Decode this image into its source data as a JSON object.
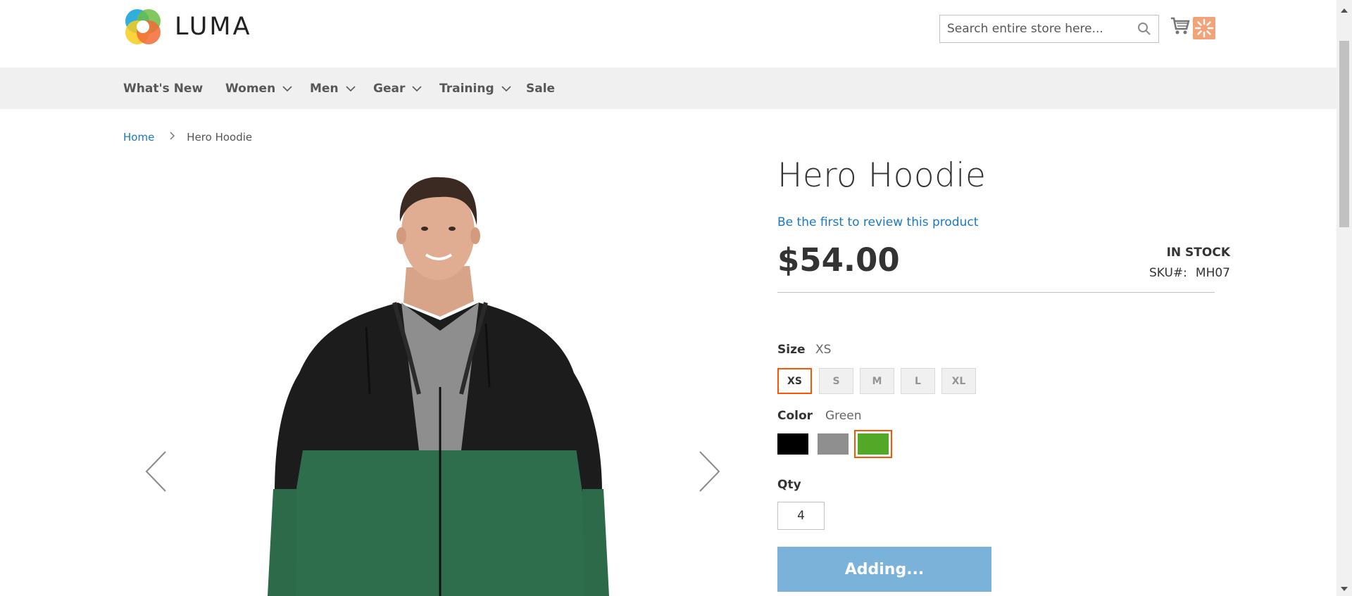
{
  "header": {
    "logo_text": "LUMA",
    "search_placeholder": "Search entire store here..."
  },
  "nav": {
    "items": [
      {
        "label": "What's New",
        "has_dropdown": false
      },
      {
        "label": "Women",
        "has_dropdown": true
      },
      {
        "label": "Men",
        "has_dropdown": true
      },
      {
        "label": "Gear",
        "has_dropdown": true
      },
      {
        "label": "Training",
        "has_dropdown": true
      },
      {
        "label": "Sale",
        "has_dropdown": false
      }
    ]
  },
  "breadcrumb": {
    "home": "Home",
    "current": "Hero Hoodie"
  },
  "product": {
    "title": "Hero Hoodie",
    "review_link": "Be the first to review this product",
    "price": "$54.00",
    "stock": "IN STOCK",
    "sku_label": "SKU#:",
    "sku_value": "MH07"
  },
  "options": {
    "size_label": "Size",
    "size_selected": "XS",
    "sizes": [
      "XS",
      "S",
      "M",
      "L",
      "XL"
    ],
    "color_label": "Color",
    "color_selected": "Green",
    "colors": [
      {
        "name": "Black",
        "hex": "#000000"
      },
      {
        "name": "Gray",
        "hex": "#8f8f8f"
      },
      {
        "name": "Green",
        "hex": "#53a828"
      }
    ]
  },
  "qty": {
    "label": "Qty",
    "value": "4"
  },
  "add_button": "Adding...",
  "colors": {
    "accent": "#ff5501",
    "link": "#1979c3",
    "nav_bg": "#f0f0f0",
    "button_bg": "#7ab2da"
  }
}
